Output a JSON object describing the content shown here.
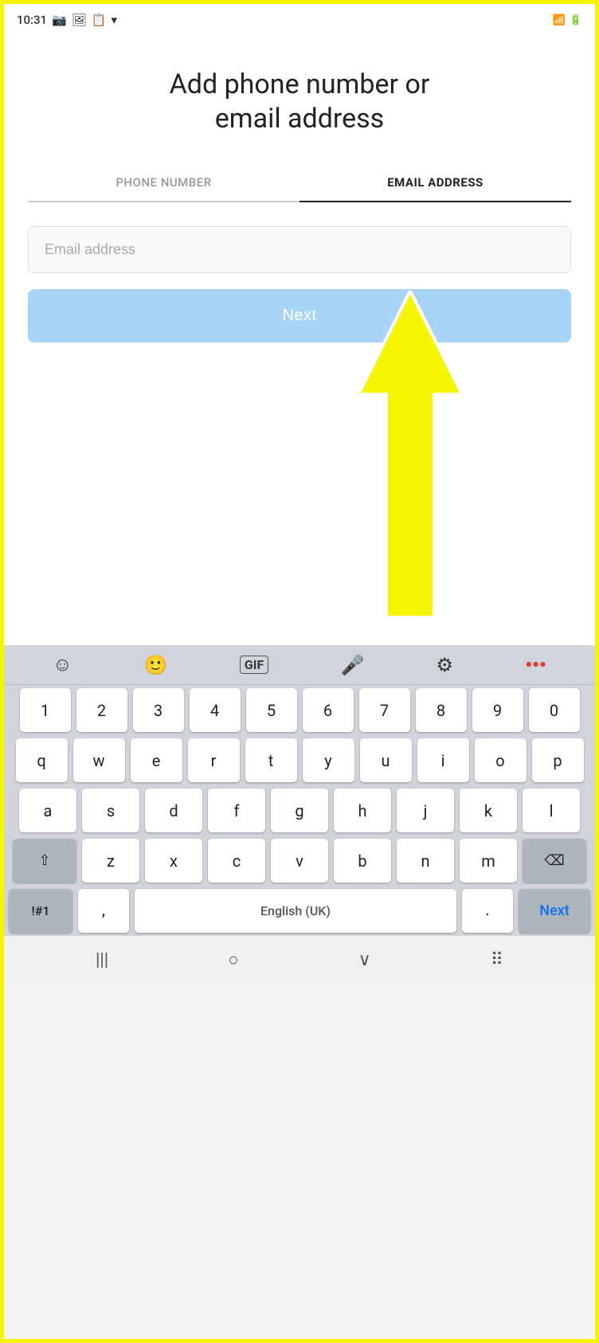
{
  "statusBar": {
    "time": "10:31",
    "icons": [
      "📷",
      "🖼",
      "📋",
      "▾"
    ]
  },
  "page": {
    "title": "Add phone number or\nemail address"
  },
  "tabs": [
    {
      "id": "phone",
      "label": "PHONE NUMBER",
      "active": false
    },
    {
      "id": "email",
      "label": "EMAIL ADDRESS",
      "active": true
    }
  ],
  "emailInput": {
    "placeholder": "Email address",
    "value": ""
  },
  "nextButton": {
    "label": "Next"
  },
  "keyboard": {
    "toolbar": {
      "emoji": "☺",
      "sticker": "🙂",
      "gif": "GIF",
      "mic": "🎤",
      "settings": "⚙",
      "more": "···"
    },
    "rows": {
      "numbers": [
        "1",
        "2",
        "3",
        "4",
        "5",
        "6",
        "7",
        "8",
        "9",
        "0"
      ],
      "row1": [
        "q",
        "w",
        "e",
        "r",
        "t",
        "y",
        "u",
        "i",
        "o",
        "p"
      ],
      "row2": [
        "a",
        "s",
        "d",
        "f",
        "g",
        "h",
        "j",
        "k",
        "l"
      ],
      "row3": [
        "z",
        "x",
        "c",
        "v",
        "b",
        "n",
        "m"
      ],
      "bottom": {
        "sym": "!#1",
        "comma": ",",
        "space": "English (UK)",
        "period": ".",
        "next": "Next"
      }
    }
  },
  "navBar": {
    "back": "|||",
    "home": "○",
    "recents": "∨",
    "apps": "⠿"
  }
}
